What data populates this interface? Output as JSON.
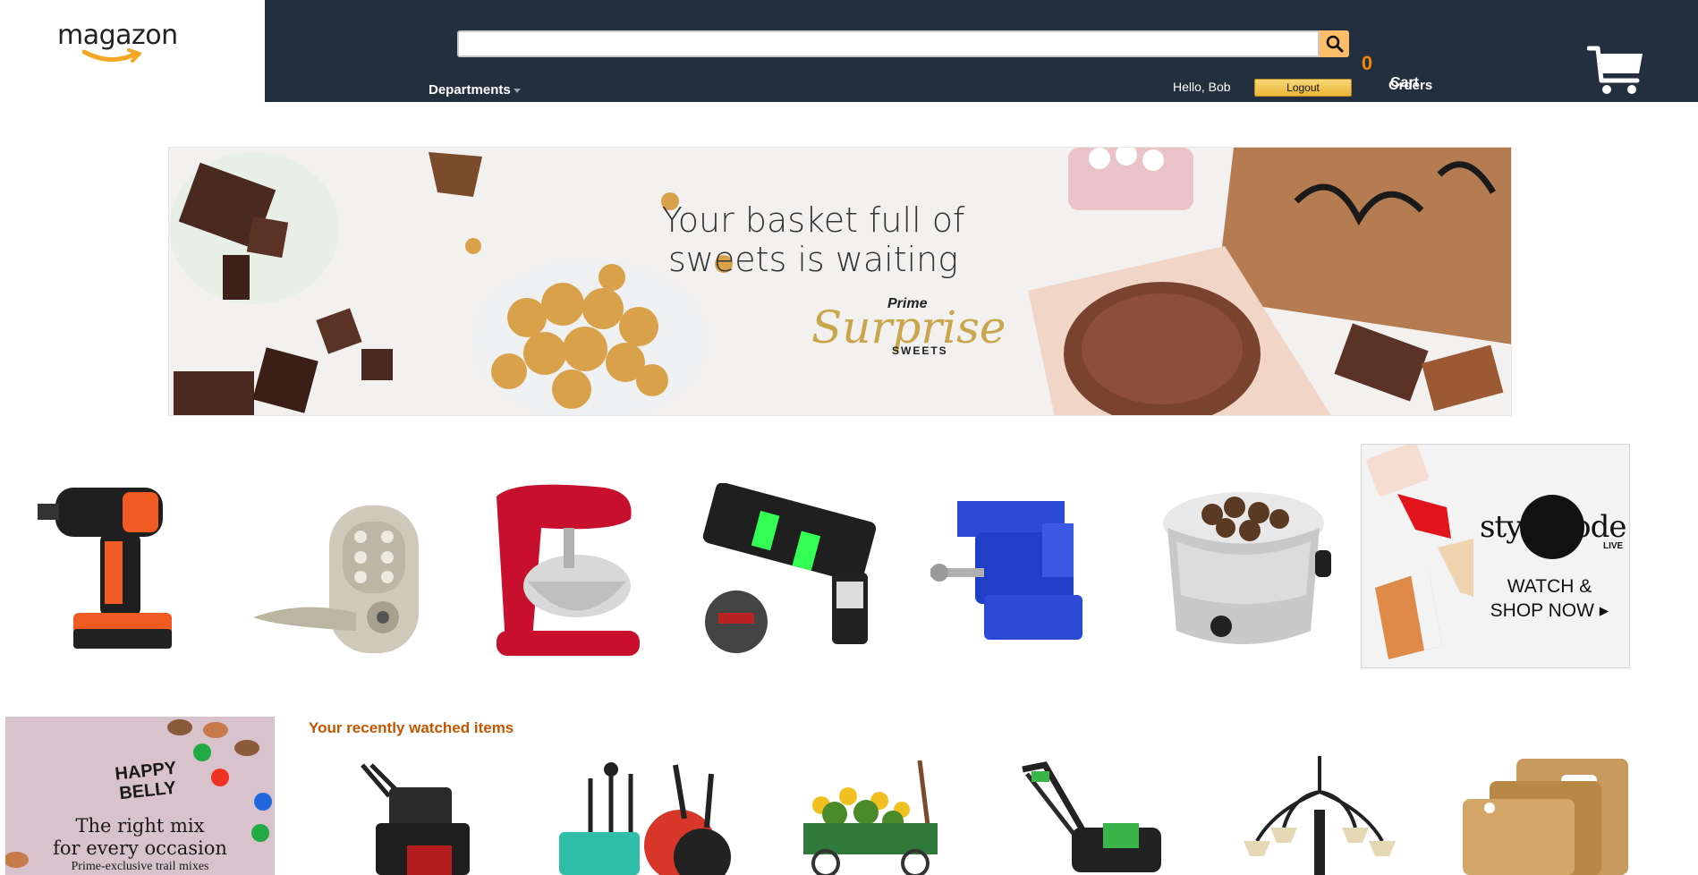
{
  "header": {
    "logo_text": "magazon",
    "search": {
      "value": "",
      "placeholder": ""
    },
    "departments_label": "Departments",
    "greeting": "Hello, Bob",
    "logout_label": "Logout",
    "orders_label": "Orders",
    "cart_count": "0",
    "cart_label": "Cart"
  },
  "hero": {
    "headline_line1": "Your basket full of",
    "headline_line2": "sweets is waiting",
    "brand_top": "Prime",
    "brand_main": "Surprise",
    "brand_sub": "SWEETS"
  },
  "products": [
    {
      "name": "cordless-drill"
    },
    {
      "name": "keypad-door-lever"
    },
    {
      "name": "stand-mixer"
    },
    {
      "name": "laser-level"
    },
    {
      "name": "bench-vise"
    },
    {
      "name": "slow-cooker"
    }
  ],
  "style_ad": {
    "title": "style code",
    "live": "LIVE",
    "cta_line1": "WATCH &",
    "cta_line2": "SHOP NOW ▸"
  },
  "side_ad": {
    "brand": "HAPPY BELLY",
    "headline_line1": "The right mix",
    "headline_line2": "for every occasion",
    "sub": "Prime-exclusive trail mixes"
  },
  "recently_watched": {
    "title": "Your recently watched items",
    "items": [
      {
        "name": "snow-blower"
      },
      {
        "name": "cookware-set"
      },
      {
        "name": "garden-cart"
      },
      {
        "name": "electric-mower"
      },
      {
        "name": "chandelier"
      },
      {
        "name": "cutting-boards"
      }
    ]
  },
  "colors": {
    "navbar": "#232f3e",
    "search_button": "#febd69",
    "cart_count": "#f08804",
    "section_title": "#c45500",
    "logout_button": "#f0c14b"
  }
}
